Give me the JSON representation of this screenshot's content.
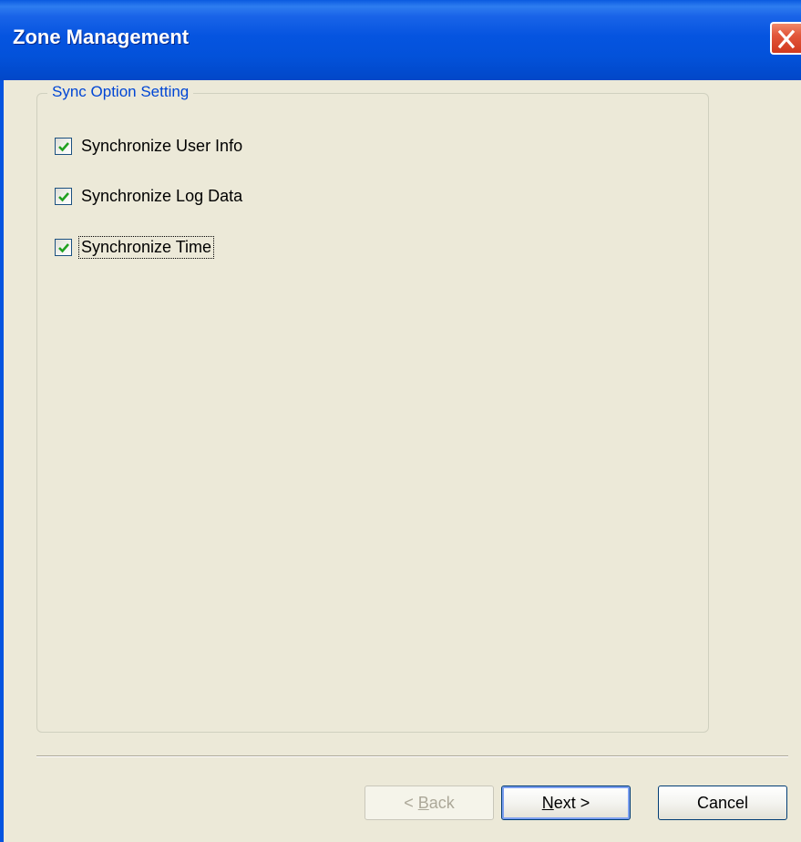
{
  "window": {
    "title": "Zone Management"
  },
  "group": {
    "legend": "Sync Option Setting",
    "options": [
      {
        "label": "Synchronize User Info",
        "checked": true
      },
      {
        "label": "Synchronize Log Data",
        "checked": true
      },
      {
        "label": "Synchronize Time",
        "checked": true,
        "focused": true
      }
    ]
  },
  "buttons": {
    "back_prefix": "< ",
    "back_mnemonic": "B",
    "back_rest": "ack",
    "next_mnemonic": "N",
    "next_rest": "ext >",
    "cancel": "Cancel"
  },
  "colors": {
    "titlebar": "#0554e0",
    "legend_text": "#0046d5",
    "dialog_bg": "#ece9d8",
    "check_mark": "#21a121",
    "close_button": "#d13a1f"
  },
  "icons": {
    "close": "close-icon",
    "check": "check-mark-icon"
  }
}
